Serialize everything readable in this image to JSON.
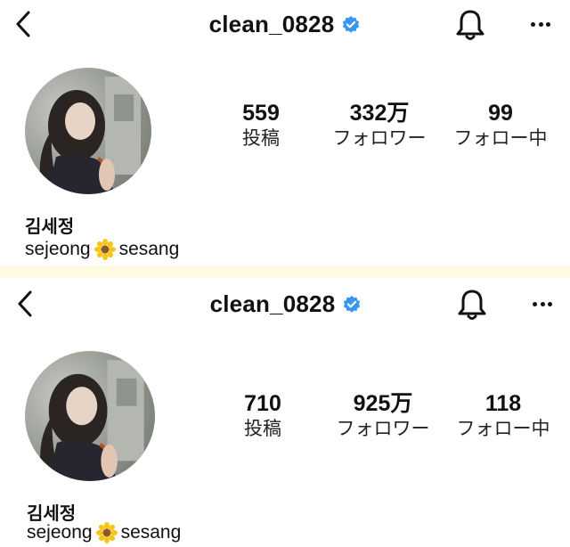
{
  "profiles": [
    {
      "username": "clean_0828",
      "stats": [
        {
          "value": "559",
          "label": "投稿"
        },
        {
          "value": "332万",
          "label": "フォロワー"
        },
        {
          "value": "99",
          "label": "フォロー中"
        }
      ],
      "name": "김세정",
      "bio": {
        "before": "sejeong",
        "after": "sesang"
      }
    },
    {
      "username": "clean_0828",
      "stats": [
        {
          "value": "710",
          "label": "投稿"
        },
        {
          "value": "925万",
          "label": "フォロワー"
        },
        {
          "value": "118",
          "label": "フォロー中"
        }
      ],
      "name": "김세정",
      "bio": {
        "before": "sejeong",
        "after": "sesang"
      }
    }
  ],
  "icons": {
    "back": "chevron-left-icon",
    "verified": "verified-badge-icon",
    "notifications": "bell-icon",
    "more": "more-horizontal-icon",
    "bio_emoji": "sunflower-icon"
  },
  "colors": {
    "divider": "#fffbe3",
    "verified": "#3897f0",
    "flower_petals": "#f5c518",
    "flower_center": "#8b5a2b"
  }
}
